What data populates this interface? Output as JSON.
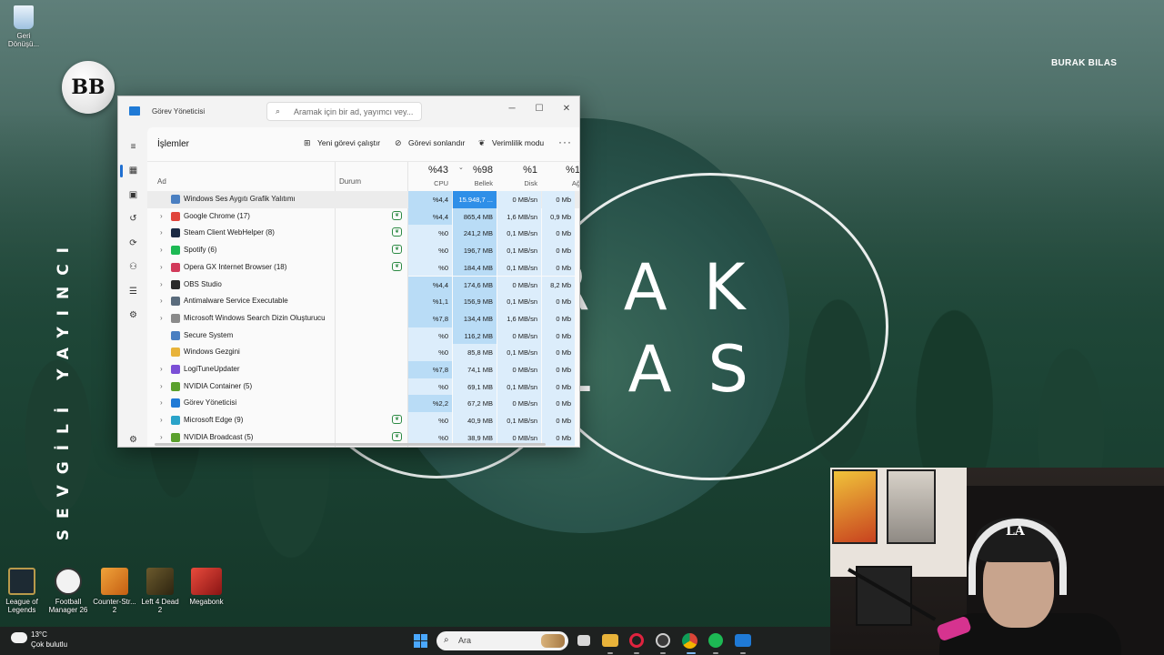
{
  "desktop": {
    "recycle_bin_label": "Geri Dönüşü...",
    "brand_top": "BURAK BILAS",
    "bb_logo": "BB",
    "side_text": "SEVGİLİ YAYINCI",
    "big_line1": "RAK",
    "big_line2": "LAS",
    "icons": [
      {
        "label": "League of Legends",
        "color": "#b99a4b"
      },
      {
        "label": "Football Manager 26",
        "color": "#f2f2f2"
      },
      {
        "label": "Counter-Str... 2",
        "color": "#e18a1d"
      },
      {
        "label": "Left 4 Dead 2",
        "color": "#6b5a2d"
      },
      {
        "label": "Megabonk",
        "color": "#c22d2d"
      }
    ]
  },
  "task_manager": {
    "window_title": "Görev Yöneticisi",
    "search_placeholder": "Aramak için bir ad, yayımcı vey...",
    "page_title": "İşlemler",
    "toolbar": {
      "new_task": "Yeni görevi çalıştır",
      "end_task": "Görevi sonlandır",
      "efficiency": "Verimlilik modu",
      "more": "···"
    },
    "columns": {
      "name": "Ad",
      "status": "Durum",
      "cpu_pct": "%43",
      "cpu_label": "CPU",
      "mem_pct": "%98",
      "mem_label": "Bellek",
      "disk_pct": "%1",
      "disk_label": "Disk",
      "net_pct": "%1",
      "net_label": "Ağ"
    },
    "processes": [
      {
        "name": "Windows Ses Aygıtı Grafik Yalıtımı",
        "expand": "",
        "eco": false,
        "cpu": "%4,4",
        "mem": "15.948,7 ...",
        "disk": "0 MB/sn",
        "net": "0 Mb",
        "icon": "#4a7fc1"
      },
      {
        "name": "Google Chrome (17)",
        "expand": "›",
        "eco": true,
        "cpu": "%4,4",
        "mem": "865,4 MB",
        "disk": "1,6 MB/sn",
        "net": "0,9 Mb",
        "icon": "#e0443b"
      },
      {
        "name": "Steam Client WebHelper (8)",
        "expand": "›",
        "eco": true,
        "cpu": "%0",
        "mem": "241,2 MB",
        "disk": "0,1 MB/sn",
        "net": "0 Mb",
        "icon": "#1b2a44"
      },
      {
        "name": "Spotify (6)",
        "expand": "›",
        "eco": true,
        "cpu": "%0",
        "mem": "196,7 MB",
        "disk": "0,1 MB/sn",
        "net": "0 Mb",
        "icon": "#1db954"
      },
      {
        "name": "Opera GX Internet Browser (18)",
        "expand": "›",
        "eco": true,
        "cpu": "%0",
        "mem": "184,4 MB",
        "disk": "0,1 MB/sn",
        "net": "0 Mb",
        "icon": "#d23a5a"
      },
      {
        "name": "OBS Studio",
        "expand": "›",
        "eco": false,
        "cpu": "%4,4",
        "mem": "174,6 MB",
        "disk": "0 MB/sn",
        "net": "8,2 Mb",
        "icon": "#2b2b2b"
      },
      {
        "name": "Antimalware Service Executable",
        "expand": "›",
        "eco": false,
        "cpu": "%1,1",
        "mem": "156,9 MB",
        "disk": "0,1 MB/sn",
        "net": "0 Mb",
        "icon": "#5a6b7c"
      },
      {
        "name": "Microsoft Windows Search Dizin Oluşturucu",
        "expand": "›",
        "eco": false,
        "cpu": "%7,8",
        "mem": "134,4 MB",
        "disk": "1,6 MB/sn",
        "net": "0 Mb",
        "icon": "#8a8a8a"
      },
      {
        "name": "Secure System",
        "expand": "",
        "eco": false,
        "cpu": "%0",
        "mem": "116,2 MB",
        "disk": "0 MB/sn",
        "net": "0 Mb",
        "icon": "#4a7fc1"
      },
      {
        "name": "Windows Gezgini",
        "expand": "",
        "eco": false,
        "cpu": "%0",
        "mem": "85,8 MB",
        "disk": "0,1 MB/sn",
        "net": "0 Mb",
        "icon": "#e8b33a"
      },
      {
        "name": "LogiTuneUpdater",
        "expand": "›",
        "eco": false,
        "cpu": "%7,8",
        "mem": "74,1 MB",
        "disk": "0 MB/sn",
        "net": "0 Mb",
        "icon": "#7b4fd6"
      },
      {
        "name": "NVIDIA Container (5)",
        "expand": "›",
        "eco": false,
        "cpu": "%0",
        "mem": "69,1 MB",
        "disk": "0,1 MB/sn",
        "net": "0 Mb",
        "icon": "#5aa02c"
      },
      {
        "name": "Görev Yöneticisi",
        "expand": "›",
        "eco": false,
        "cpu": "%2,2",
        "mem": "67,2 MB",
        "disk": "0 MB/sn",
        "net": "0 Mb",
        "icon": "#1f7ad6"
      },
      {
        "name": "Microsoft Edge (9)",
        "expand": "›",
        "eco": true,
        "cpu": "%0",
        "mem": "40,9 MB",
        "disk": "0,1 MB/sn",
        "net": "0 Mb",
        "icon": "#2aa3c9"
      },
      {
        "name": "NVIDIA Broadcast (5)",
        "expand": "›",
        "eco": true,
        "cpu": "%0",
        "mem": "38,9 MB",
        "disk": "0 MB/sn",
        "net": "0 Mb",
        "icon": "#5aa02c"
      }
    ]
  },
  "taskbar": {
    "weather_temp": "13°C",
    "weather_desc": "Çok bulutlu",
    "search_placeholder": "Ara"
  },
  "colors": {
    "accent": "#1f6fd1",
    "heat_high": "#2f8fe8",
    "heat_mid": "#b9dcf6",
    "heat_low": "#dcedfb"
  }
}
